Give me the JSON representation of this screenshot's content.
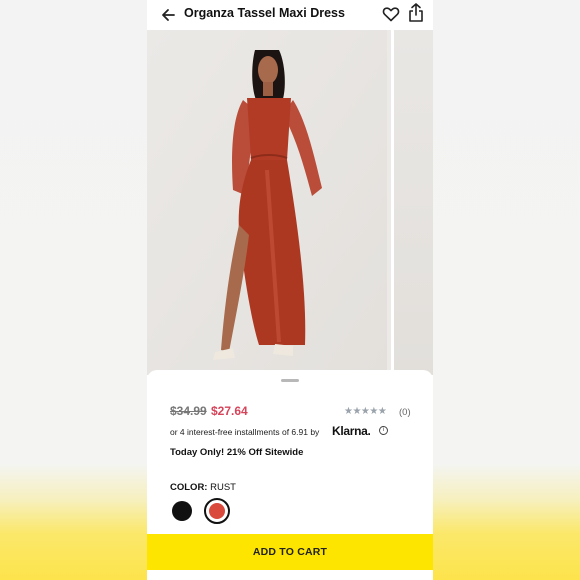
{
  "header": {
    "title": "Organza Tassel Maxi Dress",
    "back_icon": "arrow-left-icon",
    "favorite_icon": "heart-icon",
    "share_icon": "share-icon"
  },
  "product": {
    "price_original": "$34.99",
    "price_sale": "$27.64",
    "rating_stars": "★★★★★",
    "review_count": "(0)",
    "installments_text": "or 4 interest-free installments of 6.91 by",
    "installments_provider": "Klarna.",
    "info_icon": "i",
    "promo_text": "Today Only! 21% Off Sitewide",
    "color_label": "COLOR:",
    "color_value": "RUST",
    "colors": [
      {
        "name": "black",
        "hex": "#111111",
        "selected": false
      },
      {
        "name": "rust",
        "hex": "#d9493c",
        "selected": true
      }
    ]
  },
  "actions": {
    "add_to_cart_label": "ADD TO CART"
  },
  "theme": {
    "sale_color": "#d6445a",
    "cta_color": "#fde500"
  }
}
